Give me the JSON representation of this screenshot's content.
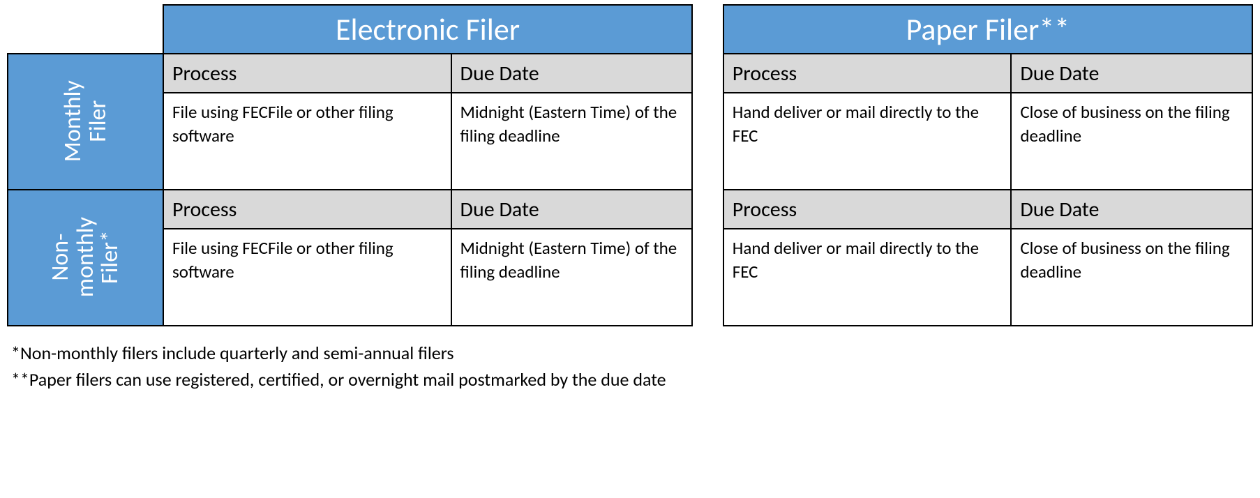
{
  "colors": {
    "header_fill": "#5B9BD5",
    "header_text": "#FFFFFF",
    "subhdr_fill": "#D9D9D9",
    "border": "#000000"
  },
  "column_headers": {
    "electronic": "Electronic Filer",
    "paper": "Paper Filer**"
  },
  "row_headers": {
    "monthly": "Monthly\nFiler",
    "non_monthly": "Non-\nmonthly\nFiler*"
  },
  "sub_headers": {
    "process": "Process",
    "due_date": "Due Date"
  },
  "cells": {
    "monthly": {
      "electronic": {
        "process": "File using FECFile or other filing software",
        "due_date": "Midnight (Eastern Time) of the filing deadline"
      },
      "paper": {
        "process": "Hand deliver or mail directly to the FEC",
        "due_date": "Close of business on the filing deadline"
      }
    },
    "non_monthly": {
      "electronic": {
        "process": "File using FECFile or other filing software",
        "due_date": "Midnight (Eastern Time) of the filing deadline"
      },
      "paper": {
        "process": "Hand deliver or mail directly to the FEC",
        "due_date": "Close of business on the filing deadline"
      }
    }
  },
  "footnotes": {
    "line1": "*Non-monthly filers include quarterly and semi-annual filers",
    "line2": "**Paper filers can use registered, certified, or overnight mail postmarked by the due date"
  }
}
